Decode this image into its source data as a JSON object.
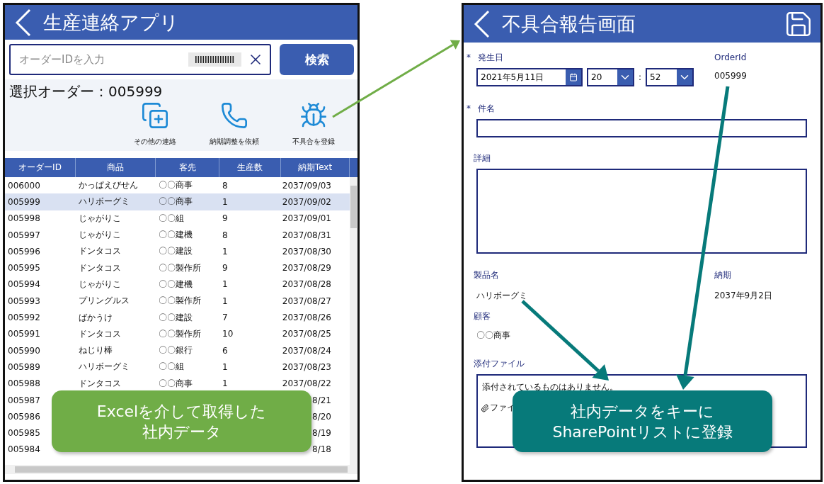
{
  "left_app": {
    "title": "生産連絡アプリ",
    "search": {
      "placeholder": "オーダーIDを入力"
    },
    "search_button": "検索",
    "selected_order": "選択オーダー：005999",
    "actions": [
      {
        "kind": "copy",
        "label": "その他の連絡"
      },
      {
        "kind": "phone",
        "label": "納期調整を依頼"
      },
      {
        "kind": "bug",
        "label": "不具合を登録"
      }
    ],
    "table": {
      "columns": [
        "オーダーID",
        "商品",
        "客先",
        "生産数",
        "納期Text"
      ],
      "rows": [
        {
          "cells": [
            "006000",
            "かっぱえびせん",
            "〇〇商事",
            "8",
            "2037/09/03"
          ],
          "selected": false
        },
        {
          "cells": [
            "005999",
            "ハリボーグミ",
            "〇〇商事",
            "1",
            "2037/09/02"
          ],
          "selected": true
        },
        {
          "cells": [
            "005998",
            "じゃがりこ",
            "〇〇組",
            "9",
            "2037/09/01"
          ],
          "selected": false
        },
        {
          "cells": [
            "005997",
            "じゃがりこ",
            "〇〇建機",
            "8",
            "2037/08/31"
          ],
          "selected": false
        },
        {
          "cells": [
            "005996",
            "ドンタコス",
            "〇〇建設",
            "1",
            "2037/08/30"
          ],
          "selected": false
        },
        {
          "cells": [
            "005995",
            "ドンタコス",
            "〇〇製作所",
            "9",
            "2037/08/29"
          ],
          "selected": false
        },
        {
          "cells": [
            "005994",
            "じゃがりこ",
            "〇〇建機",
            "1",
            "2037/08/28"
          ],
          "selected": false
        },
        {
          "cells": [
            "005993",
            "プリングルス",
            "〇〇製作所",
            "1",
            "2037/08/27"
          ],
          "selected": false
        },
        {
          "cells": [
            "005992",
            "ばかうけ",
            "〇〇建設",
            "7",
            "2037/08/26"
          ],
          "selected": false
        },
        {
          "cells": [
            "005991",
            "ドンタコス",
            "〇〇製作所",
            "10",
            "2037/08/25"
          ],
          "selected": false
        },
        {
          "cells": [
            "005990",
            "ねじり棒",
            "〇〇銀行",
            "6",
            "2037/08/24"
          ],
          "selected": false
        },
        {
          "cells": [
            "005989",
            "ハリボーグミ",
            "〇〇組",
            "1",
            "2037/08/23"
          ],
          "selected": false
        },
        {
          "cells": [
            "005988",
            "ドンタコス",
            "〇〇商事",
            "1",
            "2037/08/22"
          ],
          "selected": false
        },
        {
          "cells": [
            "005987",
            "",
            "",
            "",
            "8/21"
          ],
          "selected": false
        },
        {
          "cells": [
            "005986",
            "",
            "",
            "",
            "8/20"
          ],
          "selected": false
        },
        {
          "cells": [
            "005985",
            "",
            "",
            "",
            "8/19"
          ],
          "selected": false
        },
        {
          "cells": [
            "005984",
            "",
            "",
            "",
            "8/18"
          ],
          "selected": false
        }
      ]
    }
  },
  "right_app": {
    "title": "不具合報告画面",
    "occurred": {
      "label": "発生日",
      "required_mark": "*",
      "date": "2021年5月11日",
      "hour": "20",
      "separator": ":",
      "minute": "52"
    },
    "order_id": {
      "label": "OrderId",
      "value": "005999"
    },
    "subject": {
      "label": "件名",
      "required_mark": "*"
    },
    "details": {
      "label": "詳細"
    },
    "product": {
      "label": "製品名",
      "value": "ハリボーグミ"
    },
    "due": {
      "label": "納期",
      "value": "2037年9月2日"
    },
    "customer": {
      "label": "顧客",
      "value": "〇〇商事"
    },
    "attachments": {
      "label": "添付ファイル",
      "empty_text": "添付されているものはありません。",
      "attach_link": "ファイ"
    }
  },
  "callouts": [
    {
      "lines": [
        "Excelを介して取得した",
        "社内データ"
      ],
      "color": "#70ad47"
    },
    {
      "lines": [
        "社内データをキーに",
        "SharePointリストに登録"
      ],
      "color": "#077a7a"
    }
  ]
}
